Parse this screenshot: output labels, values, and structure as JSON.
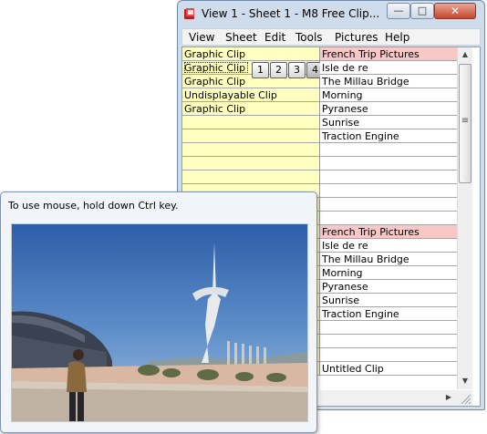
{
  "window": {
    "title": "View 1  -  Sheet 1  -  M8 Free Clip...",
    "minimize_glyph": "—",
    "maximize_glyph": "□",
    "close_glyph": "✕"
  },
  "menubar": [
    "View",
    "Sheet",
    "Edit",
    "Tools",
    "Pictures",
    "Help"
  ],
  "left_column": [
    "Graphic Clip",
    "Graphic Clip",
    "Graphic Clip",
    "Undisplayable Clip",
    "Graphic Clip"
  ],
  "sheet_tabs": [
    "1",
    "2",
    "3",
    "4"
  ],
  "right_column_top": [
    "French Trip Pictures",
    "Isle de re",
    "The Millau Bridge",
    "Morning",
    "Pyranese",
    "Sunrise",
    "Traction Engine"
  ],
  "right_column_bottom": [
    "French Trip Pictures",
    "Isle de re",
    "The Millau Bridge",
    "Morning",
    "Pyranese",
    "Sunrise",
    "Traction Engine"
  ],
  "untitled": "Untitled Clip",
  "scroll": {
    "up": "▲",
    "down": "▼",
    "right": "▶",
    "grip": "≡"
  },
  "popup": {
    "hint": "To use mouse, hold down Ctrl key."
  },
  "colors": {
    "clip_column": "#ffffbf",
    "group_header": "#f8c8c8",
    "close_button": "#c7452c"
  }
}
